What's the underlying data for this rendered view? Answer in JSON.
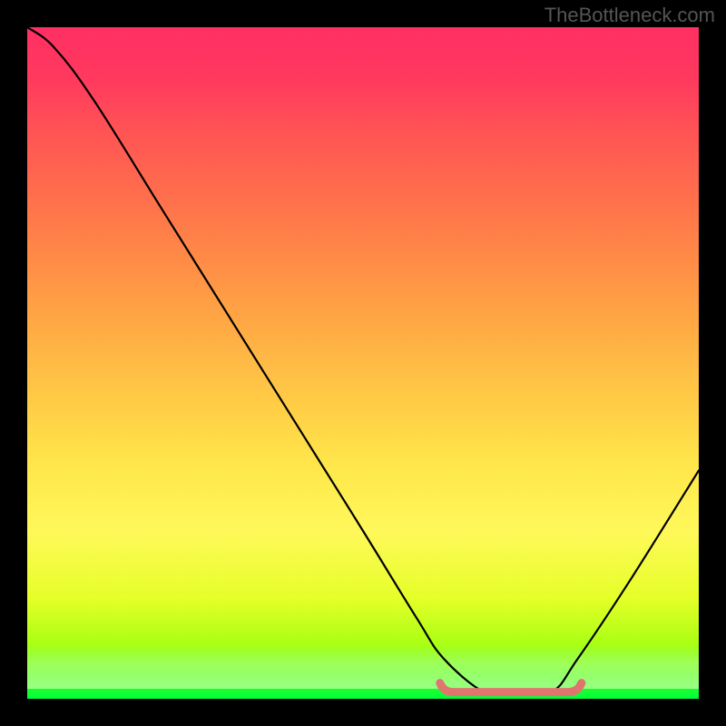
{
  "watermark": "TheBottleneck.com",
  "chart_data": {
    "type": "line",
    "title": "",
    "xlabel": "",
    "ylabel": "",
    "xlim": [
      0,
      100
    ],
    "ylim": [
      0,
      100
    ],
    "grid": false,
    "legend": false,
    "series": [
      {
        "name": "bottleneck-curve",
        "x": [
          0,
          4,
          10,
          20,
          30,
          40,
          50,
          58,
          62,
          68,
          72,
          78,
          82,
          90,
          100
        ],
        "values": [
          100,
          97,
          89,
          73,
          57,
          41,
          25,
          12,
          6,
          1,
          1,
          1,
          6,
          18,
          34
        ]
      }
    ],
    "highlight": {
      "name": "optimal-range",
      "x_start": 62,
      "x_end": 82,
      "y": 1,
      "color": "#e0756e"
    },
    "background_gradient_stops": [
      {
        "pos": 0.0,
        "color": "#00ff3a"
      },
      {
        "pos": 0.15,
        "color": "#e6ff28"
      },
      {
        "pos": 0.35,
        "color": "#ffe64a"
      },
      {
        "pos": 0.55,
        "color": "#ffab44"
      },
      {
        "pos": 0.75,
        "color": "#ff6e4c"
      },
      {
        "pos": 1.0,
        "color": "#ff2f63"
      }
    ]
  }
}
